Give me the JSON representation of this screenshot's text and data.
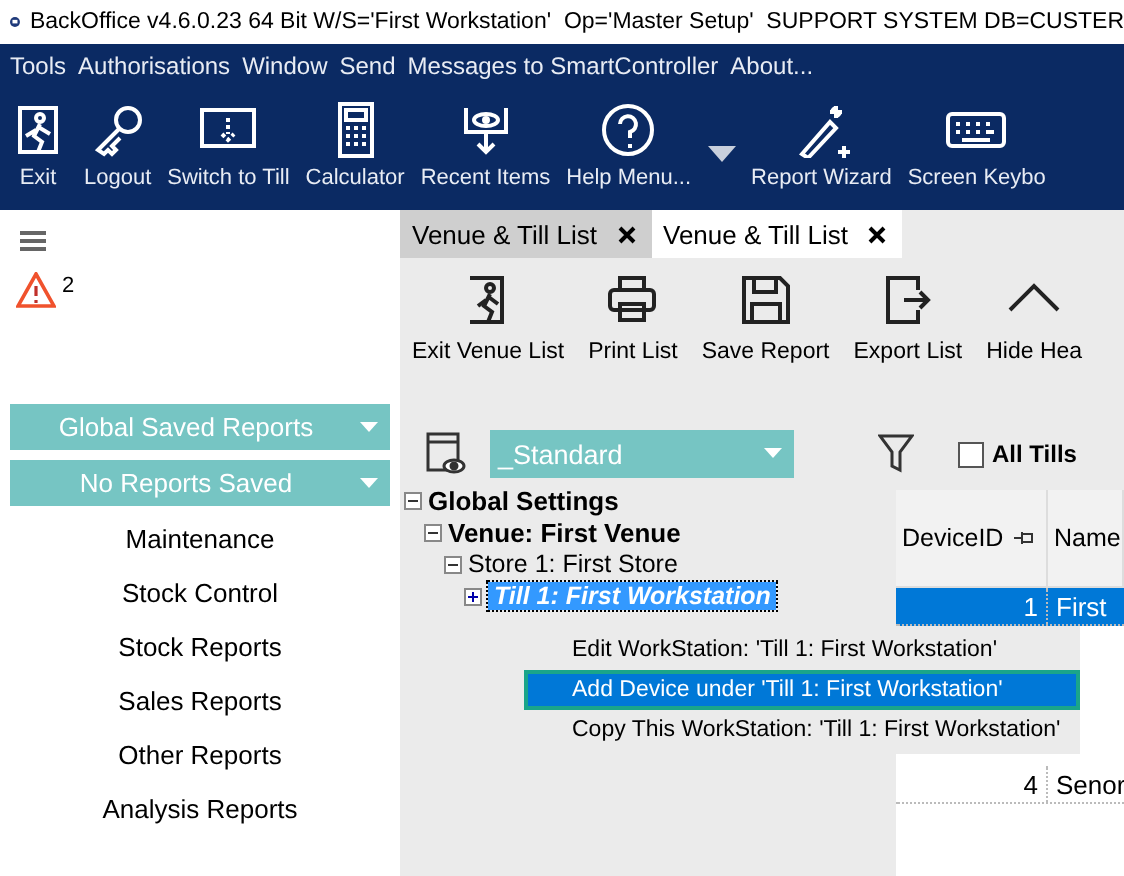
{
  "window": {
    "title": "BackOffice v4.6.0.23 64 Bit W/S='First Workstation'  Op='Master Setup'  SUPPORT SYSTEM DB=CUSTER"
  },
  "menu": [
    "Tools",
    "Authorisations",
    "Window",
    "Send",
    "Messages to SmartController",
    "About..."
  ],
  "toolbar": [
    "Exit",
    "Logout",
    "Switch to Till",
    "Calculator",
    "Recent Items",
    "Help Menu...",
    "Report Wizard",
    "Screen Keybo"
  ],
  "sidebar": {
    "alerts": "2",
    "dropdowns": [
      "Global Saved Reports",
      "No Reports Saved"
    ],
    "items": [
      "Maintenance",
      "Stock Control",
      "Stock Reports",
      "Sales Reports",
      "Other Reports",
      "Analysis Reports"
    ]
  },
  "tabs": [
    {
      "label": "Venue & Till List",
      "selected": false
    },
    {
      "label": "Venue & Till List",
      "selected": true
    }
  ],
  "actions": [
    "Exit Venue List",
    "Print List",
    "Save Report",
    "Export List",
    "Hide Hea"
  ],
  "layout_select": {
    "value": "_Standard"
  },
  "all_tills": {
    "label": "All Tills",
    "checked": false
  },
  "tree": [
    {
      "label": "Global Settings",
      "expanded": true,
      "selected": false,
      "children": [
        {
          "label": "Venue: First Venue",
          "expanded": true,
          "selected": false,
          "children": [
            {
              "label": "Store 1: First Store",
              "expanded": true,
              "selected": false,
              "children": [
                {
                  "label": "Till 1: First Workstation",
                  "expanded": false,
                  "selected": true
                }
              ]
            }
          ]
        }
      ]
    }
  ],
  "grid": {
    "columns": [
      "DeviceID",
      "Name"
    ],
    "rows": [
      {
        "id": "1",
        "name": "First",
        "selected": true
      },
      {
        "id": "4",
        "name": "Senor",
        "selected": false
      }
    ]
  },
  "context_menu": [
    {
      "label": "Edit WorkStation: 'Till 1: First Workstation'",
      "selected": false
    },
    {
      "label": "Add Device under 'Till 1: First Workstation'",
      "selected": true
    },
    {
      "label": "Copy This WorkStation: 'Till 1: First Workstation'",
      "selected": false
    }
  ]
}
